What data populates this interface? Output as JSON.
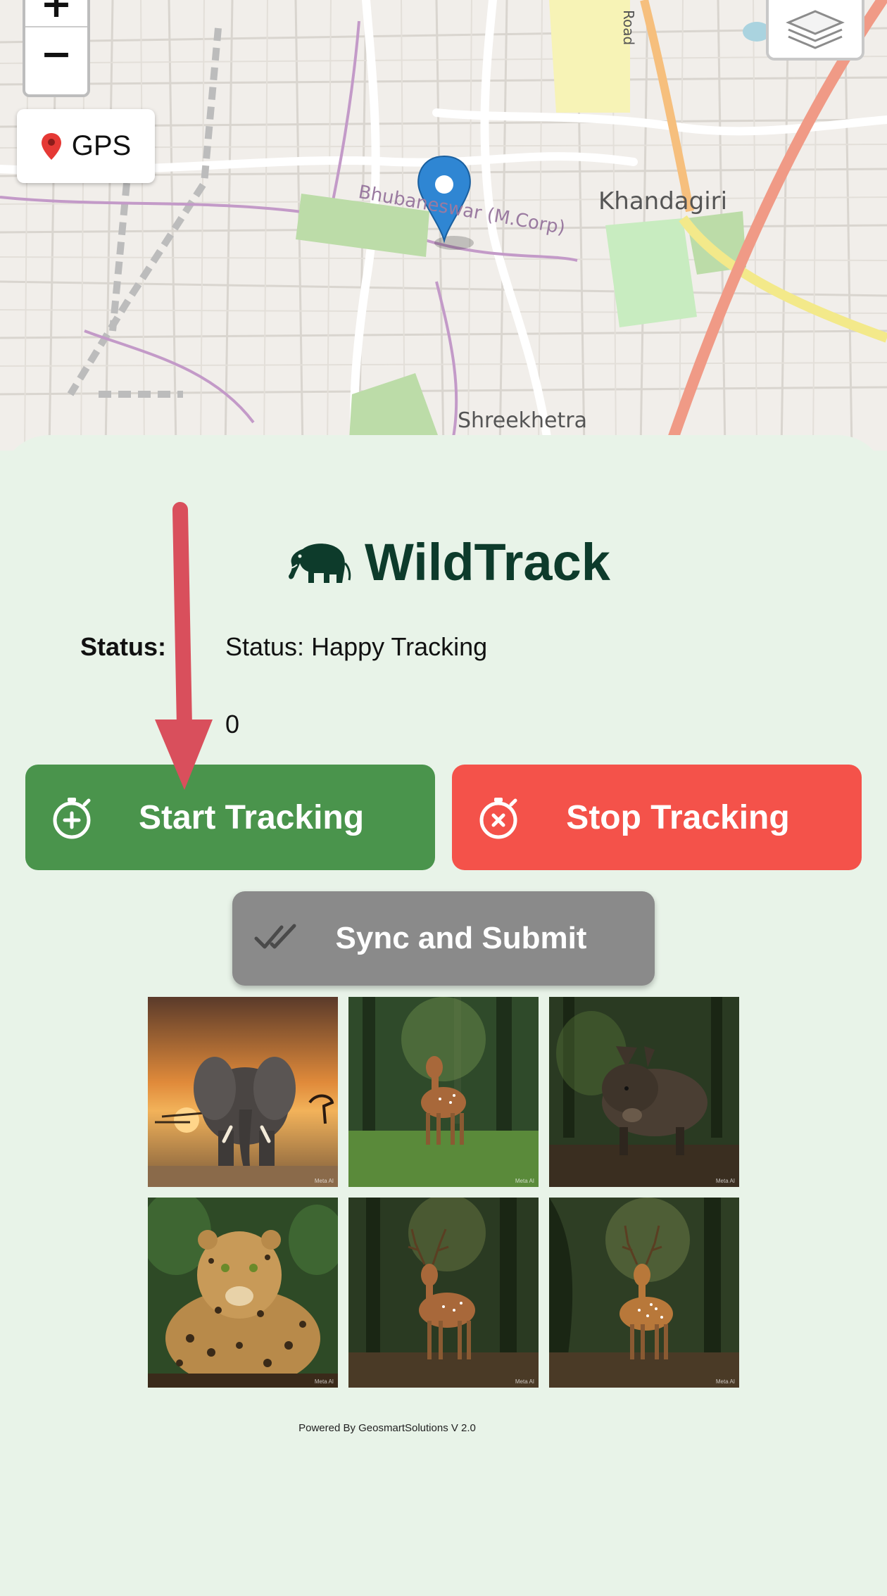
{
  "map": {
    "labels": {
      "area_khandagiri": "Khandagiri",
      "area_shreekhetra": "Shreekhetra",
      "area_bhubaneswar": "Bhubaneswar (M.Corp)",
      "road": "Road"
    },
    "controls": {
      "zoom_in": "+",
      "zoom_out": "−",
      "gps_label": "GPS",
      "gps_icon": "pin-icon",
      "layers_icon": "layers-icon"
    },
    "marker_icon": "map-marker-icon",
    "colors": {
      "marker": "#2f86d3",
      "highway": "#f09a86",
      "park": "#c8e6b4"
    }
  },
  "app": {
    "title": "WildTrack",
    "logo_icon": "elephant-icon",
    "status_label": "Status:",
    "status_text": "Status: Happy Tracking",
    "count": "0"
  },
  "buttons": {
    "start": {
      "label": "Start Tracking",
      "icon": "stopwatch-plus-icon",
      "color": "#4a944c"
    },
    "stop": {
      "label": "Stop Tracking",
      "icon": "stopwatch-x-icon",
      "color": "#f4524a"
    },
    "sync": {
      "label": "Sync and Submit",
      "icon": "double-check-icon",
      "color": "#8a8a8a"
    }
  },
  "gallery": {
    "items": [
      {
        "animal": "Elephant",
        "watermark": "Meta AI"
      },
      {
        "animal": "Deer",
        "watermark": "Meta AI"
      },
      {
        "animal": "Wild Boar",
        "watermark": "Meta AI"
      },
      {
        "animal": "Leopard",
        "watermark": "Meta AI"
      },
      {
        "animal": "Stag",
        "watermark": "Meta AI"
      },
      {
        "animal": "Spotted Deer",
        "watermark": "Meta AI"
      }
    ]
  },
  "footer": {
    "text": "Powered By GeosmartSolutions V 2.0"
  },
  "annotation": {
    "arrow_color": "#d94f5c"
  }
}
